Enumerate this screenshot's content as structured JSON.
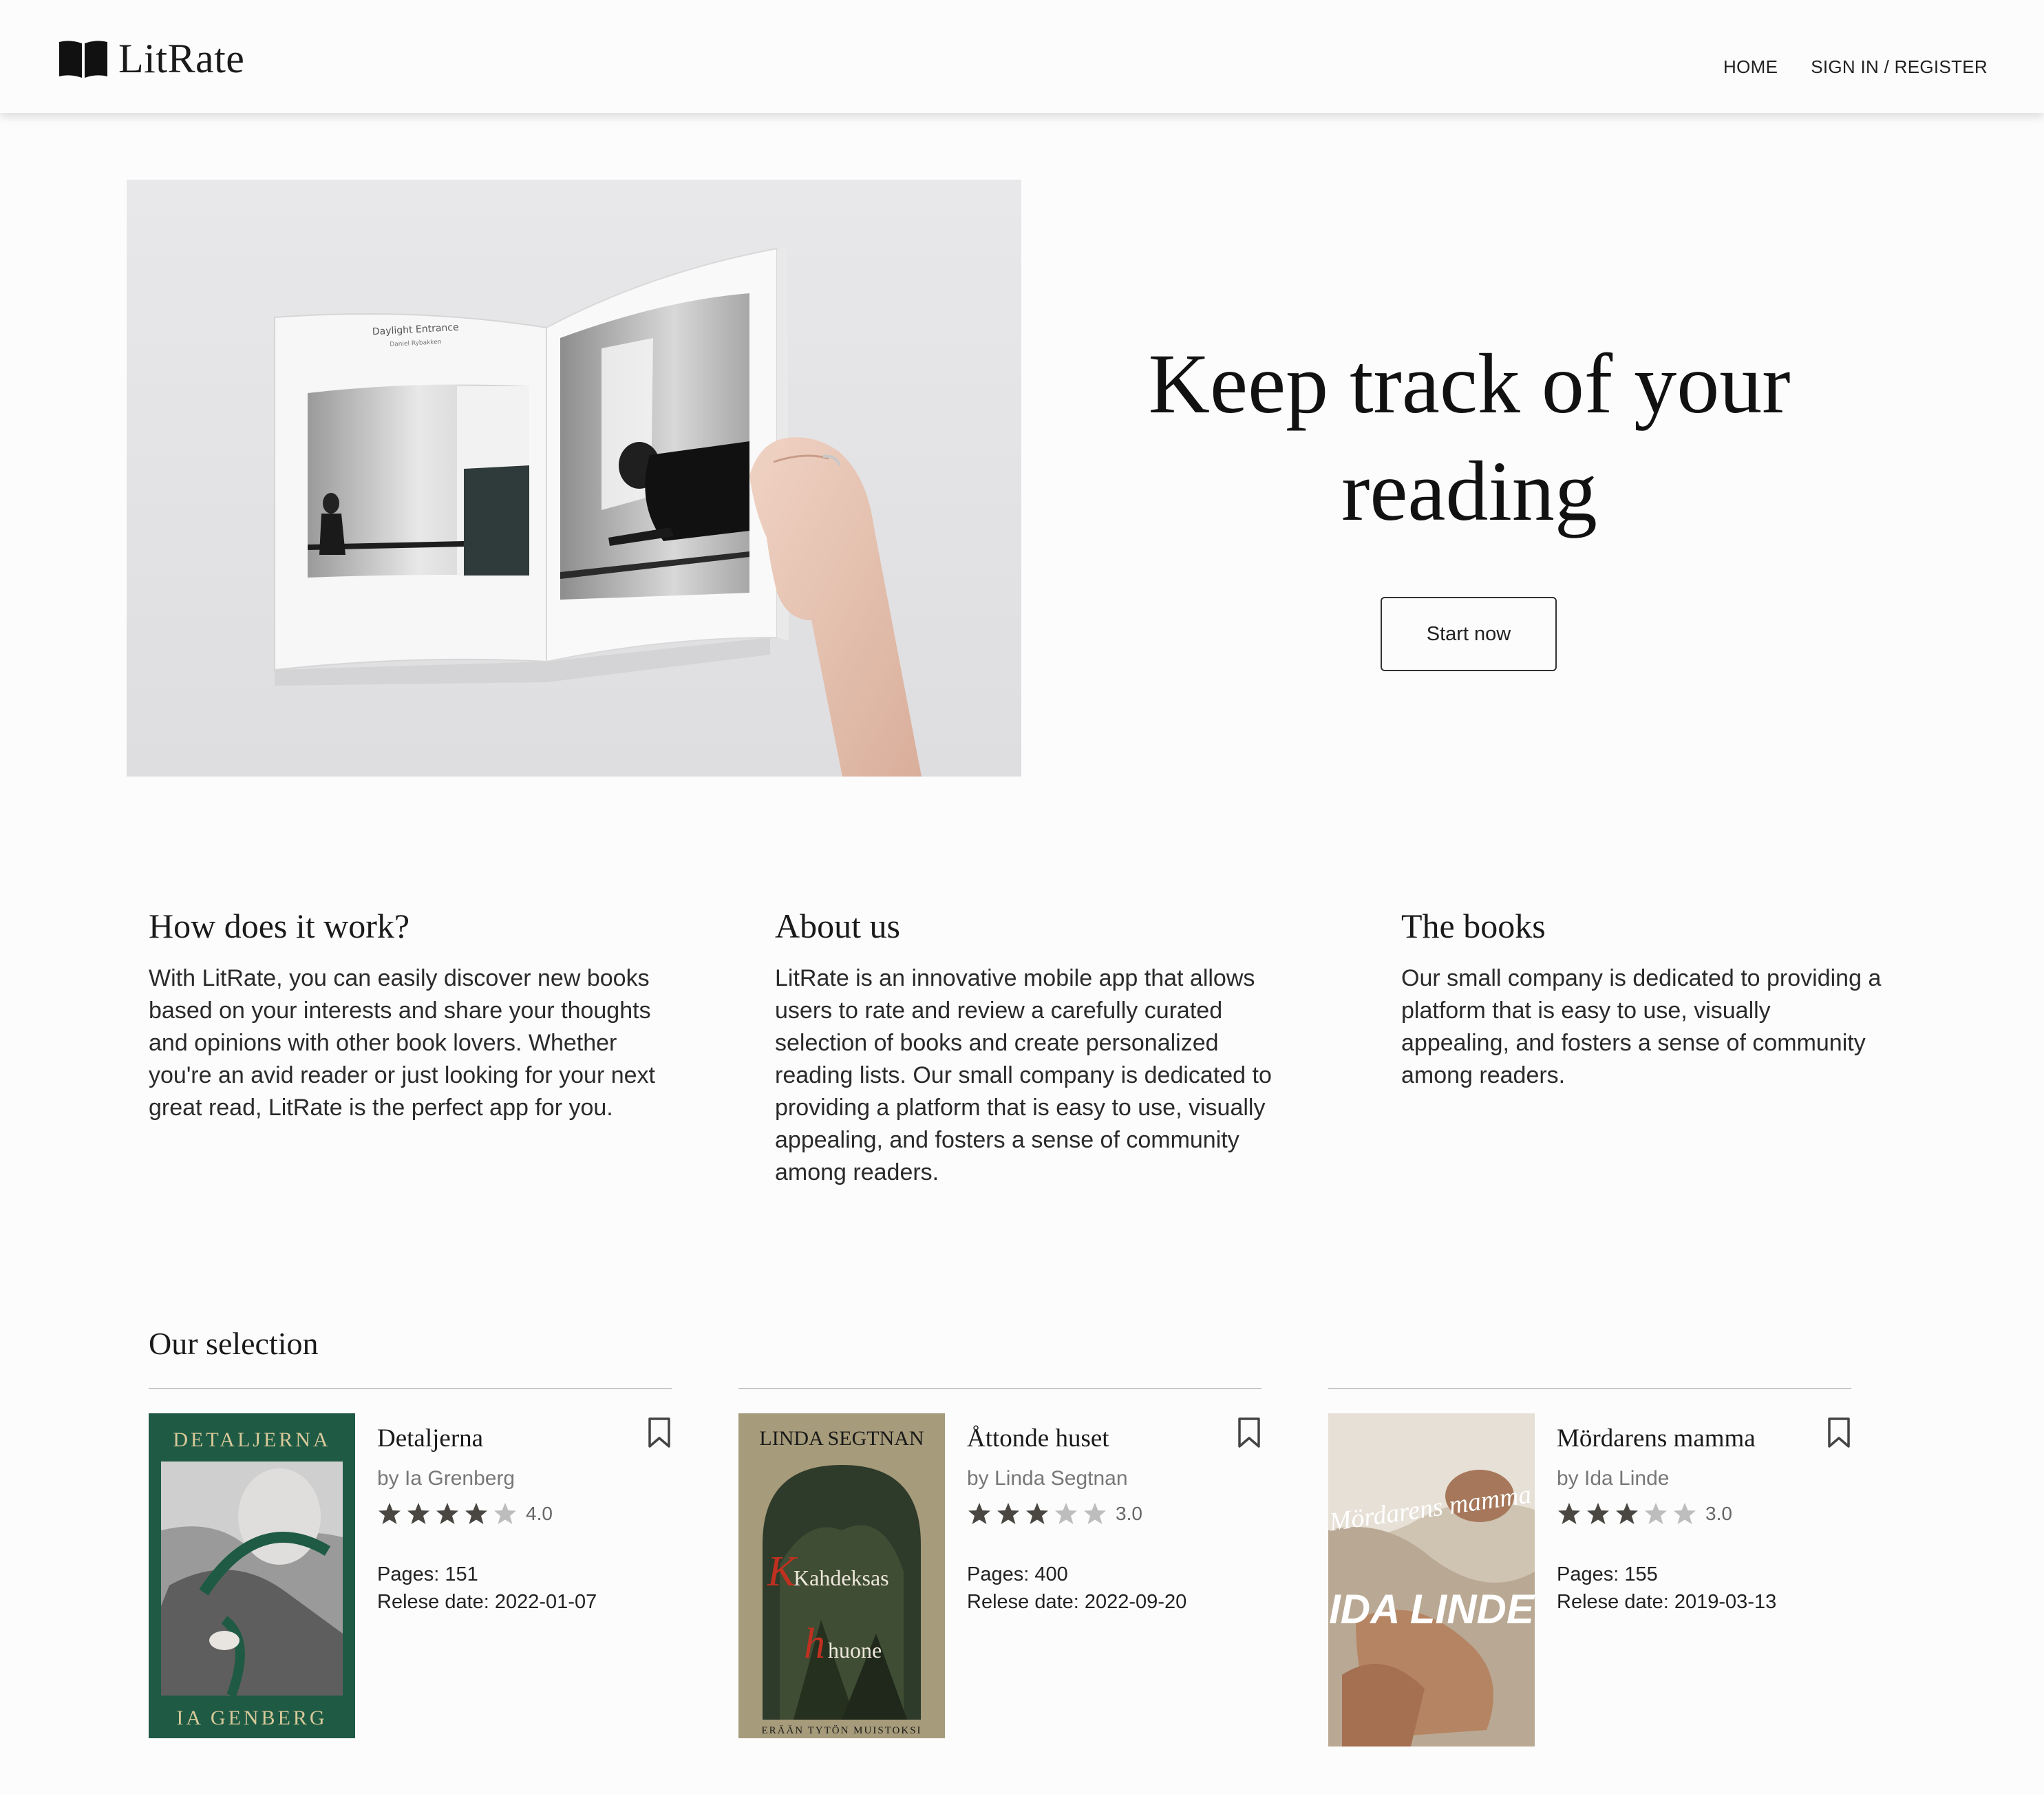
{
  "header": {
    "app_name": "LitRate",
    "logo_icon": "open-book-icon",
    "nav": [
      {
        "label": "HOME"
      },
      {
        "label": "SIGN IN / REGISTER"
      }
    ]
  },
  "hero": {
    "title": "Keep track of your reading",
    "button_label": "Start now",
    "image": {
      "left_page_title": "Daylight Entrance",
      "left_page_author": "Daniel Rybakken"
    }
  },
  "info": [
    {
      "title": "How does it work?",
      "text": "With LitRate, you can easily discover new books based on your interests and share your thoughts and opinions with other book lovers. Whether you're an avid reader or just looking for your next great read, LitRate is the perfect app for you."
    },
    {
      "title": "About us",
      "text": "LitRate is an innovative mobile app that allows users to rate and review a carefully curated selection of books and create personalized reading lists. Our small company is dedicated to providing a platform that is easy to use, visually appealing, and fosters a sense of community among readers."
    },
    {
      "title": "The books",
      "text": "Our small company is dedicated to providing a platform that is easy to use, visually appealing, and fosters a sense of community among readers."
    }
  ],
  "selection": {
    "title": "Our selection",
    "books": [
      {
        "title": "Detaljerna",
        "author": "by Ia Grenberg",
        "rating": 4,
        "rating_label": "4.0",
        "pages": "Pages: 151",
        "release": "Relese date: 2022-01-07",
        "cover": {
          "top": "DETALJERNA",
          "bottom": "IA GENBERG",
          "bg": "#1f5a44",
          "accent": "#d9c99a"
        }
      },
      {
        "title": "Åttonde huset",
        "author": "by Linda Segtnan",
        "rating": 3,
        "rating_label": "3.0",
        "pages": "Pages: 400",
        "release": "Relese date: 2022-09-20",
        "cover": {
          "top": "LINDA SEGTNAN",
          "middle1": "Kahdeksas",
          "middle2": "huone",
          "bottom": "ERÄÄN TYTÖN MUISTOKSI",
          "bg": "#a69b7a"
        }
      },
      {
        "title": "Mördarens mamma",
        "author": "by Ida Linde",
        "rating": 3,
        "rating_label": "3.0",
        "pages": "Pages: 155",
        "release": "Relese date: 2019-03-13",
        "cover": {
          "script": "Mördarens mamma",
          "author": "IDA LINDE",
          "bg": "#cfc3b2"
        }
      }
    ]
  },
  "colors": {
    "background": "#fcfcfc",
    "star_filled": "#4a4642",
    "star_empty": "#bdbdbd",
    "text": "#222222"
  }
}
